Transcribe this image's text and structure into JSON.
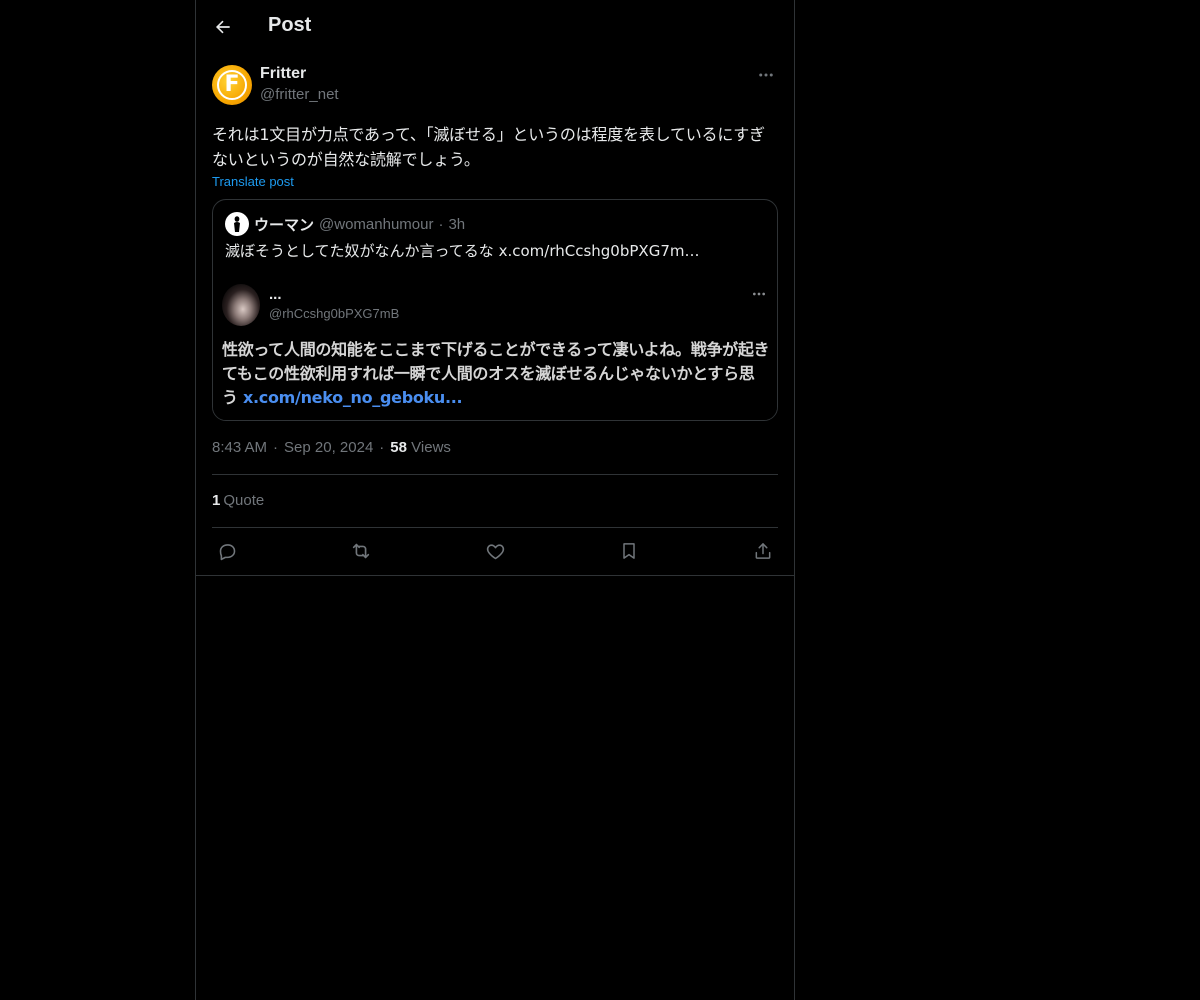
{
  "header": {
    "title": "Post"
  },
  "post": {
    "author": {
      "display_name": "Fritter",
      "handle": "@fritter_net",
      "avatar_letter": "F"
    },
    "text": "それは1文目が力点であって、「滅ぼせる」というのは程度を表しているにすぎないというのが自然な読解でしょう。",
    "translate_label": "Translate post",
    "quoted": {
      "display_name": "ウーマン",
      "handle": "@womanhumour",
      "dot": "·",
      "time": "3h",
      "text": "滅ぼそうとしてた奴がなんか言ってるな",
      "link": "x.com/rhCcshg0bPXG7m…",
      "embedded": {
        "name": "...",
        "handle": "@rhCcshg0bPXG7mB",
        "text": "性欲って人間の知能をここまで下げることができるって凄いよね。戦争が起きてもこの性欲利用すれば一瞬で人間のオスを滅ぼせるんじゃないかとすら思う",
        "link": "x.com/neko_no_geboku..."
      }
    },
    "meta": {
      "time": "8:43 AM",
      "sep1": "·",
      "date": "Sep 20, 2024",
      "sep2": "·",
      "views_count": "58",
      "views_label": "Views"
    },
    "stats": {
      "quote_count": "1",
      "quote_label": "Quote"
    }
  },
  "icons": {
    "back": "arrow-left-icon",
    "more": "ellipsis-icon",
    "reply": "reply-bubble-icon",
    "repost": "repost-icon",
    "like": "heart-icon",
    "bookmark": "bookmark-icon",
    "share": "share-icon"
  },
  "colors": {
    "background": "#000000",
    "text": "#e7e9ea",
    "muted": "#71767b",
    "border": "#2f3336",
    "accent": "#1d9bf0"
  }
}
